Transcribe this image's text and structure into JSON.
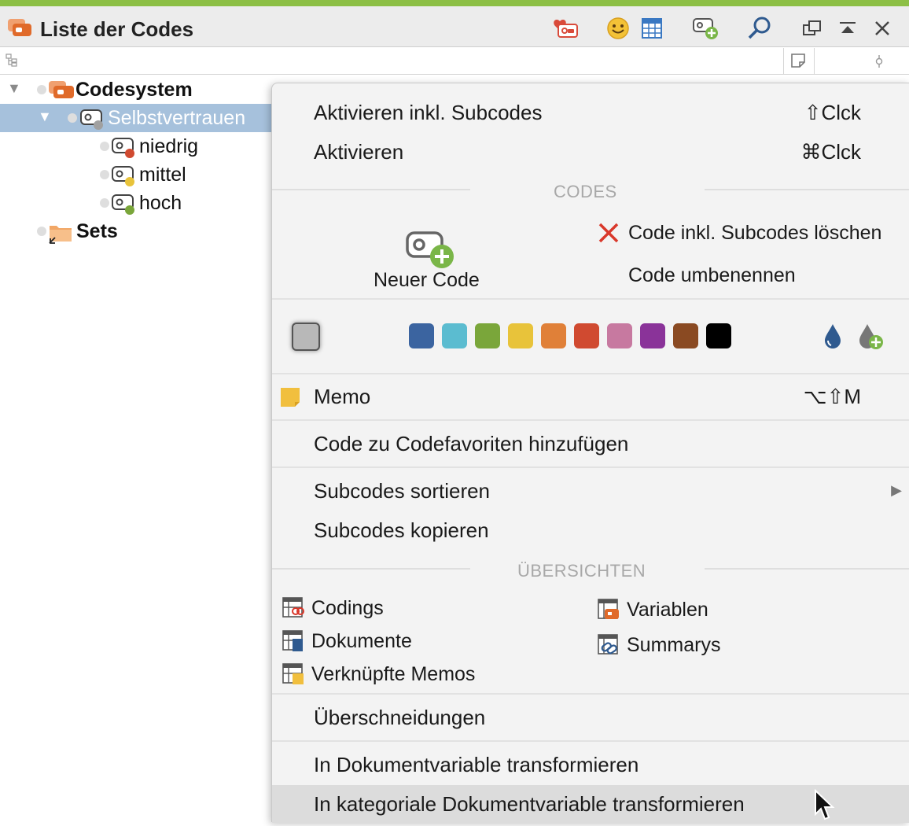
{
  "window": {
    "title": "Liste der Codes",
    "accent": "#8cbf45",
    "toolbar_icons": [
      "code-activation-icon",
      "emoticon-icon",
      "table-icon",
      "new-code-icon",
      "search-icon",
      "undock-icon",
      "collapse-up-icon",
      "close-icon"
    ]
  },
  "tree": {
    "items": [
      {
        "label": "Codesystem",
        "icon": "codesystem-icon",
        "expanded": true
      },
      {
        "label": "Selbstvertrauen",
        "icon": "code-icon",
        "expanded": true,
        "selected": true,
        "color": "#a0a0a0"
      },
      {
        "label": "niedrig",
        "icon": "code-icon",
        "color": "#d04a30"
      },
      {
        "label": "mittel",
        "icon": "code-icon",
        "color": "#e8c33a"
      },
      {
        "label": "hoch",
        "icon": "code-icon",
        "color": "#7aa63a"
      },
      {
        "label": "Sets",
        "icon": "sets-folder-icon"
      }
    ]
  },
  "menu": {
    "activate_subcodes": {
      "label": "Aktivieren inkl. Subcodes",
      "shortcut": "⇧Clck"
    },
    "activate": {
      "label": "Aktivieren",
      "shortcut": "⌘Clck"
    },
    "section_codes": "CODES",
    "new_code": "Neuer Code",
    "delete_code": "Code inkl. Subcodes löschen",
    "rename_code": "Code umbenennen",
    "colors": {
      "current": "#b8b8b8",
      "palette": [
        "#3b64a0",
        "#5bbcd0",
        "#7aa63a",
        "#e8c33a",
        "#e08038",
        "#d04a30",
        "#c779a0",
        "#8a3399",
        "#8a4a22",
        "#000000"
      ]
    },
    "memo": {
      "label": "Memo",
      "shortcut": "⌥⇧M"
    },
    "add_favorite": "Code zu Codefavoriten hinzufügen",
    "sort_subcodes": "Subcodes sortieren",
    "copy_subcodes": "Subcodes kopieren",
    "section_overviews": "ÜBERSICHTEN",
    "overviews_left": [
      "Codings",
      "Dokumente",
      "Verknüpfte Memos"
    ],
    "overviews_right": [
      "Variablen",
      "Summarys"
    ],
    "intersections": "Überschneidungen",
    "to_doc_variable": "In Dokumentvariable transformieren",
    "to_cat_doc_variable": "In kategoriale Dokumentvariable transformieren"
  }
}
